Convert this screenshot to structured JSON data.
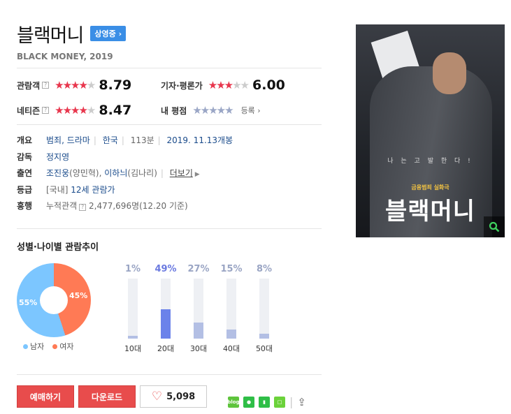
{
  "movie": {
    "title": "블랙머니",
    "status_badge": "상영중 ›",
    "subtitle": "BLACK MONEY, 2019"
  },
  "ratings": {
    "audience": {
      "label": "관람객",
      "score": "8.79",
      "stars": 4.4
    },
    "critics": {
      "label": "기자·평론가",
      "score": "6.00",
      "stars": 3.0
    },
    "netizen": {
      "label": "네티즌",
      "score": "8.47",
      "stars": 4.2
    },
    "mine": {
      "label": "내 평점",
      "register": "등록 ›"
    }
  },
  "info": {
    "overview_label": "개요",
    "genre": "범죄, 드라마",
    "country": "한국",
    "runtime": "113분",
    "release": "2019. 11.13개봉",
    "director_label": "감독",
    "director": "정지영",
    "cast_label": "출연",
    "cast1": "조진웅",
    "cast1_role": "(양민혁),",
    "cast2": "이하늬",
    "cast2_role": "(김나리)",
    "more": "더보기",
    "rating_label": "등급",
    "rating_prefix": "[국내]",
    "rating": "12세 관람가",
    "boxoffice_label": "흥행",
    "boxoffice_prefix": "누적관객",
    "boxoffice": "2,477,696명(12.20 기준)"
  },
  "trend": {
    "title": "성별·나이별 관람추이",
    "gender": {
      "male_label": "남자",
      "female_label": "여자",
      "male_pct": "55%",
      "female_pct": "45%"
    },
    "colors": {
      "male": "#7cc6ff",
      "female": "#ff7a55",
      "age_hi": "#6b82ea",
      "age": "#b3bfe4"
    }
  },
  "chart_data": {
    "type": "bar",
    "categories": [
      "10대",
      "20대",
      "30대",
      "40대",
      "50대"
    ],
    "values": [
      1,
      49,
      27,
      15,
      8
    ],
    "labels": [
      "1%",
      "49%",
      "27%",
      "15%",
      "8%"
    ],
    "ylim": [
      0,
      100
    ]
  },
  "actions": {
    "reserve": "예매하기",
    "download": "다운로드",
    "likes": "5,098"
  },
  "poster": {
    "tagline": "나 는 고 발 한 다 !",
    "sub": "금융범죄 실화극",
    "title": "블랙머니"
  }
}
